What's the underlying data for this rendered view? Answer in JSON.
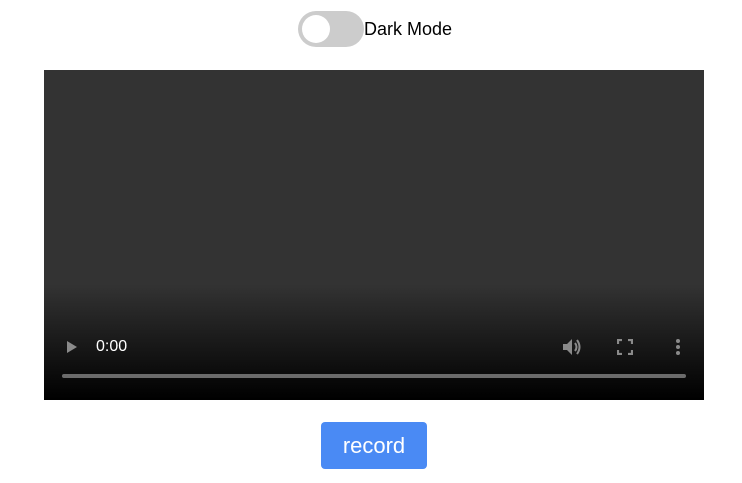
{
  "theme_toggle": {
    "label": "Dark Mode",
    "checked": false,
    "track_color": "#cccccc",
    "knob_color": "#ffffff"
  },
  "video_player": {
    "current_time": "0:00",
    "background_color": "#333333",
    "controls": {
      "play_icon": "play-icon",
      "volume_icon": "volume-icon",
      "fullscreen_icon": "fullscreen-icon",
      "more_icon": "more-options-icon"
    },
    "progress": 0
  },
  "record_button": {
    "label": "record",
    "color": "#4a8af4"
  }
}
